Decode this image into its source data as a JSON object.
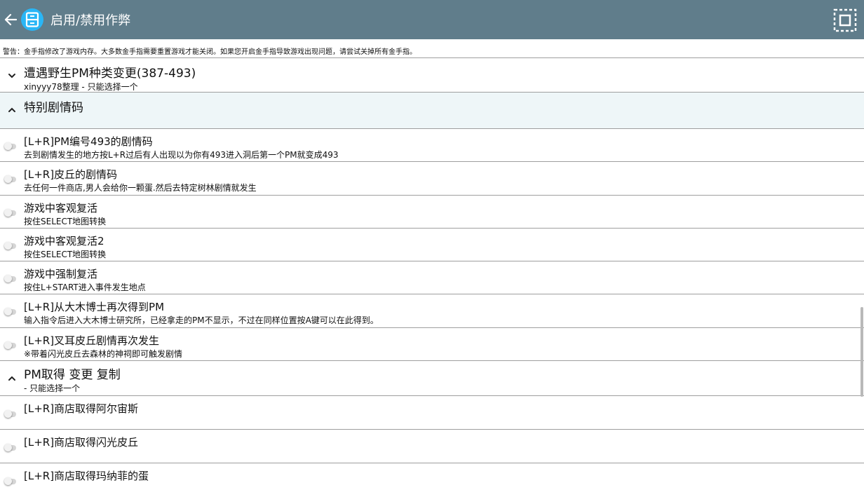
{
  "header": {
    "title": "启用/禁用作弊",
    "back_icon": "arrow-left-icon",
    "app_icon": "save-file-icon",
    "fullscreen_icon": "fullscreen-icon",
    "bar_color": "#607d8b"
  },
  "warning": "警告：金手指修改了游戏内存。大多数金手指需要重置游戏才能关闭。如果您开启金手指导致游戏出现问题，请尝试关掉所有金手指。",
  "groups": [
    {
      "title": "遭遇野生PM种类变更(387-493)",
      "subtitle": "xinyyy78整理 - 只能选择一个",
      "expanded": false
    },
    {
      "title": "特别剧情码",
      "subtitle": "",
      "expanded": true
    },
    {
      "title": "PM取得 变更 复制",
      "subtitle": "- 只能选择一个",
      "expanded": true
    }
  ],
  "cheats": [
    {
      "title": "[L+R]PM编号493的剧情码",
      "subtitle": "去到剧情发生的地方按L+R过后有人出现以为你有493进入洞后第一个PM就变成493",
      "enabled": false
    },
    {
      "title": "[L+R]皮丘的剧情码",
      "subtitle": "去任何一件商店,男人会给你一颗蛋.然后去特定树林剧情就发生",
      "enabled": false
    },
    {
      "title": "游戏中客观复活",
      "subtitle": "按住SELECT地图转换",
      "enabled": false
    },
    {
      "title": "游戏中客观复活2",
      "subtitle": "按住SELECT地图转换",
      "enabled": false
    },
    {
      "title": "游戏中强制复活",
      "subtitle": "按住L+START进入事件发生地点",
      "enabled": false
    },
    {
      "title": "[L+R]从大木博士再次得到PM",
      "subtitle": "输入指令后进入大木博士研究所，已经拿走的PM不显示，不过在同样位置按A键可以在此得到。",
      "enabled": false
    },
    {
      "title": "[L+R]叉耳皮丘剧情再次发生",
      "subtitle": "※带着闪光皮丘去森林的神祠即可触发剧情",
      "enabled": false
    },
    {
      "title": "[L+R]商店取得阿尔宙斯",
      "subtitle": "",
      "enabled": false
    },
    {
      "title": "[L+R]商店取得闪光皮丘",
      "subtitle": "",
      "enabled": false
    },
    {
      "title": "[L+R]商店取得玛纳菲的蛋",
      "subtitle": "",
      "enabled": false
    }
  ]
}
